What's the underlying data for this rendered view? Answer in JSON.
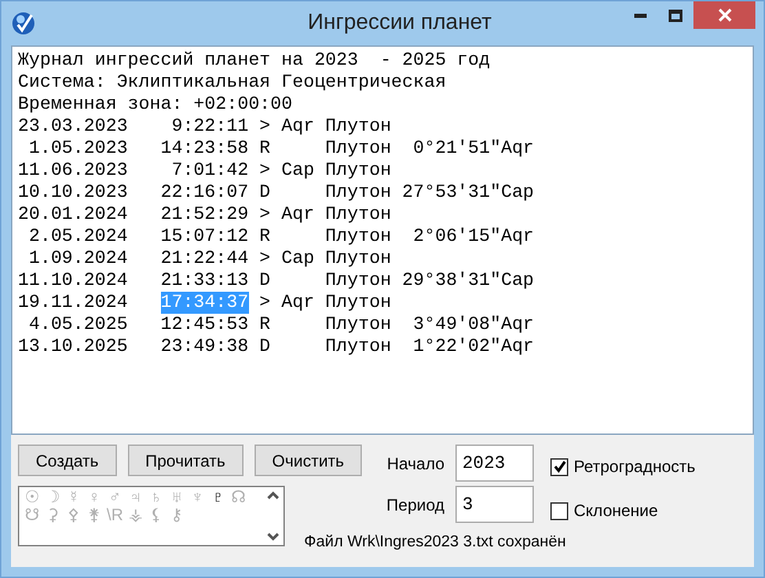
{
  "window": {
    "title": "Ингрессии планет"
  },
  "log": {
    "lines": [
      {
        "text": "Журнал ингрессий планет на 2023  - 2025 год"
      },
      {
        "text": "Система: Эклиптикальная Геоцентрическая"
      },
      {
        "text": "Временная зона: +02:00:00"
      },
      {
        "text": "23.03.2023    9:22:11 > Aqr Плутон"
      },
      {
        "text": " 1.05.2023   14:23:58 R     Плутон  0°21'51\"Aqr"
      },
      {
        "text": "11.06.2023    7:01:42 > Cap Плутон"
      },
      {
        "text": "10.10.2023   22:16:07 D     Плутон 27°53'31\"Cap"
      },
      {
        "text": "20.01.2024   21:52:29 > Aqr Плутон"
      },
      {
        "text": " 2.05.2024   15:07:12 R     Плутон  2°06'15\"Aqr"
      },
      {
        "text": " 1.09.2024   21:22:44 > Cap Плутон"
      },
      {
        "text": "11.10.2024   21:33:13 D     Плутон 29°38'31\"Cap"
      },
      {
        "segments": [
          {
            "text": "19.11.2024   ",
            "selected": false
          },
          {
            "text": "17:34:37",
            "selected": true
          },
          {
            "text": " > Aqr Плутон",
            "selected": false
          }
        ]
      },
      {
        "text": " 4.05.2025   12:45:53 R     Плутон  3°49'08\"Aqr"
      },
      {
        "text": "13.10.2025   23:49:38 D     Плутон  1°22'02\"Aqr"
      }
    ]
  },
  "buttons": [
    "Создать",
    "Прочитать",
    "Очистить"
  ],
  "planets": [
    {
      "glyph": "☉",
      "selected": false
    },
    {
      "glyph": "☽",
      "selected": false
    },
    {
      "glyph": "☿",
      "selected": false
    },
    {
      "glyph": "♀",
      "selected": false
    },
    {
      "glyph": "♂",
      "selected": false
    },
    {
      "glyph": "♃",
      "selected": false
    },
    {
      "glyph": "♄",
      "selected": false
    },
    {
      "glyph": "♅",
      "selected": false
    },
    {
      "glyph": "♆",
      "selected": false
    },
    {
      "glyph": "♇",
      "selected": true
    },
    {
      "glyph": "☊",
      "selected": false
    },
    {
      "glyph": "☋",
      "selected": false
    },
    {
      "glyph": "⚳",
      "selected": false
    },
    {
      "glyph": "⚴",
      "selected": false
    },
    {
      "glyph": "⚵",
      "selected": false
    },
    {
      "glyph": "\\R",
      "selected": false
    },
    {
      "glyph": "⚶",
      "selected": false
    },
    {
      "glyph": "⚸",
      "selected": false
    },
    {
      "glyph": "⚷",
      "selected": false
    }
  ],
  "fields": [
    {
      "label": "Начало",
      "value": "2023"
    },
    {
      "label": "Период",
      "value": "3"
    }
  ],
  "checkboxes": [
    {
      "label": "Ретроградность",
      "checked": true
    },
    {
      "label": "Склонение",
      "checked": false
    }
  ],
  "status": "Файл Wrk\\Ingres2023 3.txt сохранён"
}
